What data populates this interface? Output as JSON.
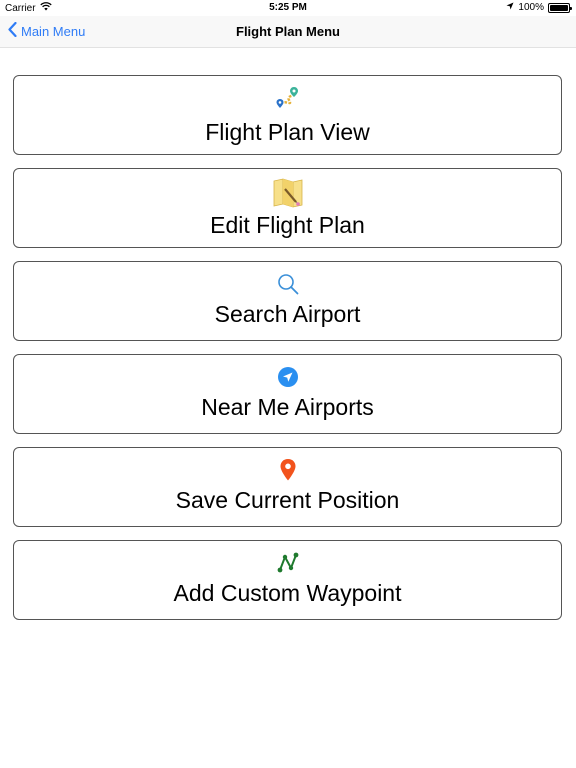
{
  "status_bar": {
    "carrier": "Carrier",
    "time": "5:25 PM",
    "battery_percent": "100%",
    "battery_level": 1.0
  },
  "nav": {
    "back_label": "Main Menu",
    "title": "Flight Plan Menu",
    "accent_color": "#2f7cf6"
  },
  "menu": {
    "items": [
      {
        "label": "Flight Plan View",
        "icon": "route-pins-icon"
      },
      {
        "label": "Edit Flight Plan",
        "icon": "folded-map-icon"
      },
      {
        "label": "Search Airport",
        "icon": "magnifier-icon"
      },
      {
        "label": "Near Me Airports",
        "icon": "location-arrow-icon"
      },
      {
        "label": "Save Current Position",
        "icon": "map-pin-icon"
      },
      {
        "label": "Add Custom Waypoint",
        "icon": "waypoint-path-icon"
      }
    ]
  }
}
